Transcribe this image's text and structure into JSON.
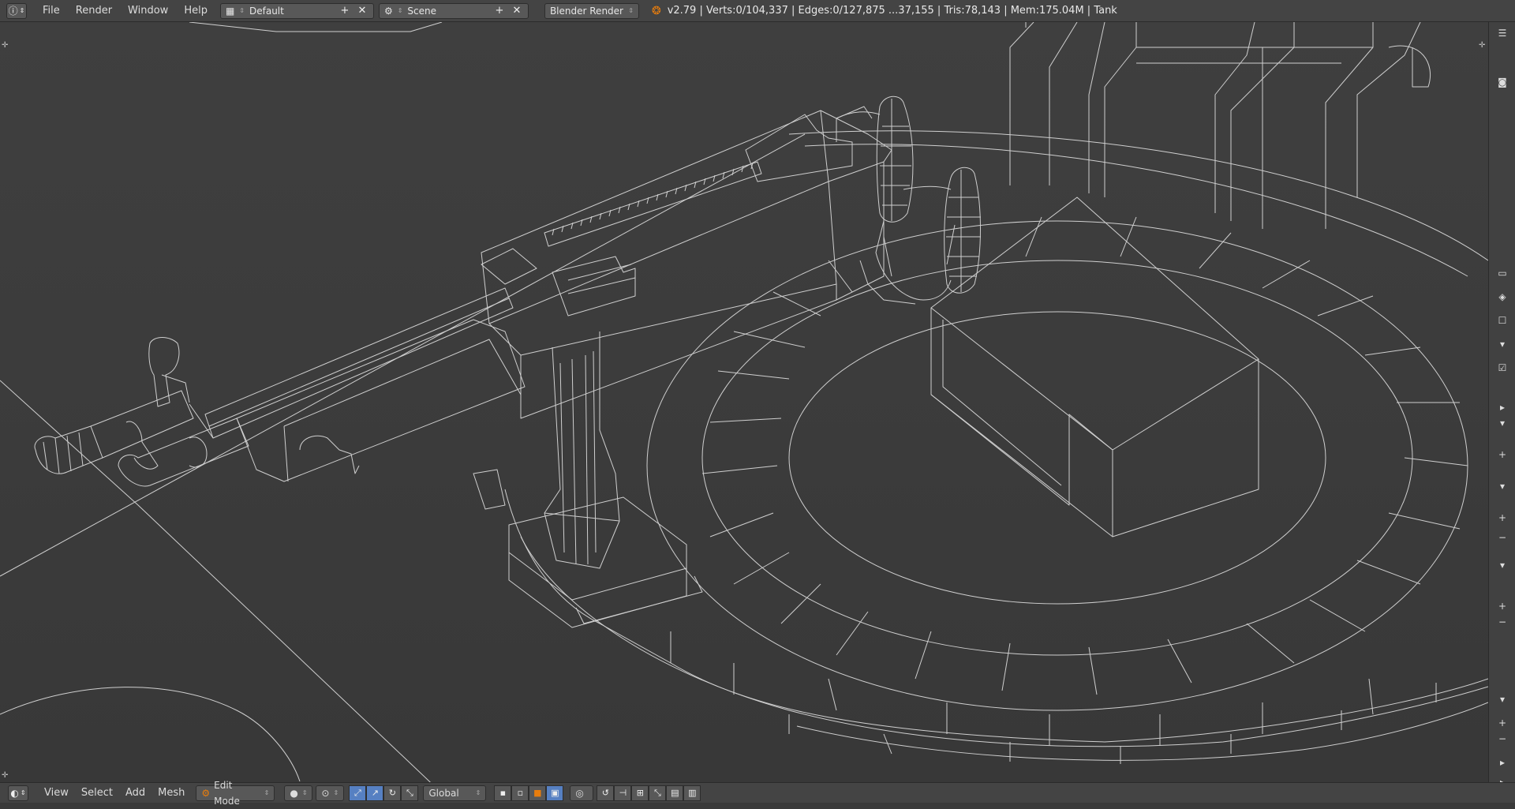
{
  "topbar": {
    "menus": [
      "File",
      "Render",
      "Window",
      "Help"
    ],
    "screen_layout": "Default",
    "scene": "Scene",
    "render_engine": "Blender Render",
    "stats": "v2.79 | Verts:0/104,337 | Edges:0/127,875 ...37,155 | Tris:78,143 | Mem:175.04M | Tank"
  },
  "bottombar": {
    "menus": [
      "View",
      "Select",
      "Add",
      "Mesh"
    ],
    "mode": "Edit Mode",
    "orientation": "Global"
  },
  "icons": {
    "info": "info-icon",
    "layout": "screen-layout-icon",
    "scene": "scene-icon",
    "blender": "blender-logo-icon",
    "viewport": "3d-view-icon",
    "mode": "edit-mode-icon"
  },
  "colors": {
    "background": "#3d3d3d",
    "header": "#444444",
    "wire": "#cfcfcf",
    "accent_blue": "#5680c2",
    "blender_orange": "#e87d0d"
  }
}
